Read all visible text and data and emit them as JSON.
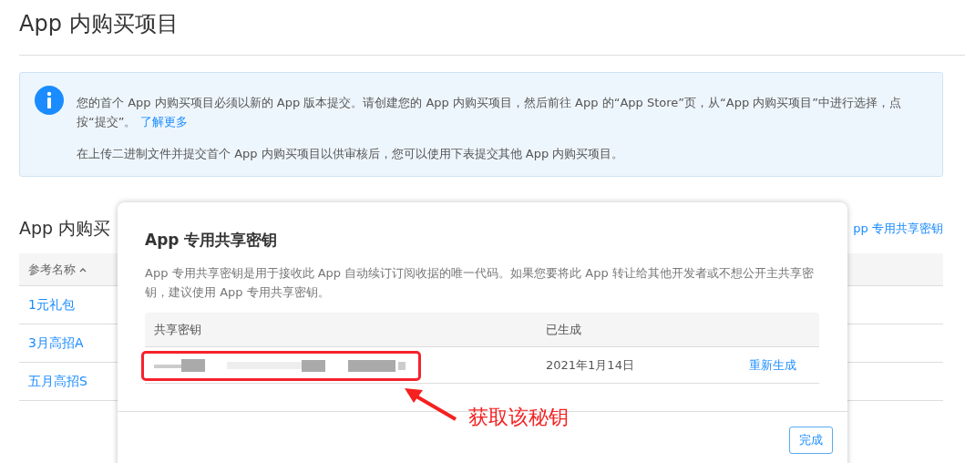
{
  "page": {
    "title": "App 内购买项目"
  },
  "notice": {
    "paragraphs": [
      "您的首个 App 内购买项目必须以新的 App 版本提交。请创建您的 App 内购买项目，然后前往 App 的“App Store”页，从“App 内购买项目”中进行选择，点按“提交”。",
      "在上传二进制文件并提交首个 App 内购买项目以供审核后，您可以使用下表提交其他 App 内购买项目。"
    ],
    "link": "了解更多"
  },
  "section": {
    "title": "App 内购买",
    "link": "pp 专用共享密钥"
  },
  "table": {
    "columns": [
      "参考名称"
    ],
    "rows": [
      "1元礼包",
      "3月高招A",
      "五月高招S"
    ]
  },
  "dialog": {
    "title": "App 专用共享密钥",
    "description": "App 专用共享密钥是用于接收此 App 自动续订订阅收据的唯一代码。如果您要将此 App 转让给其他开发者或不想公开主共享密钥，建议使用 App 专用共享密钥。",
    "columns": [
      "共享密钥",
      "已生成"
    ],
    "row": {
      "generated": "2021年1月14日",
      "action": "重新生成"
    },
    "button": "完成"
  },
  "annotation": {
    "label": "获取该秘钥"
  }
}
